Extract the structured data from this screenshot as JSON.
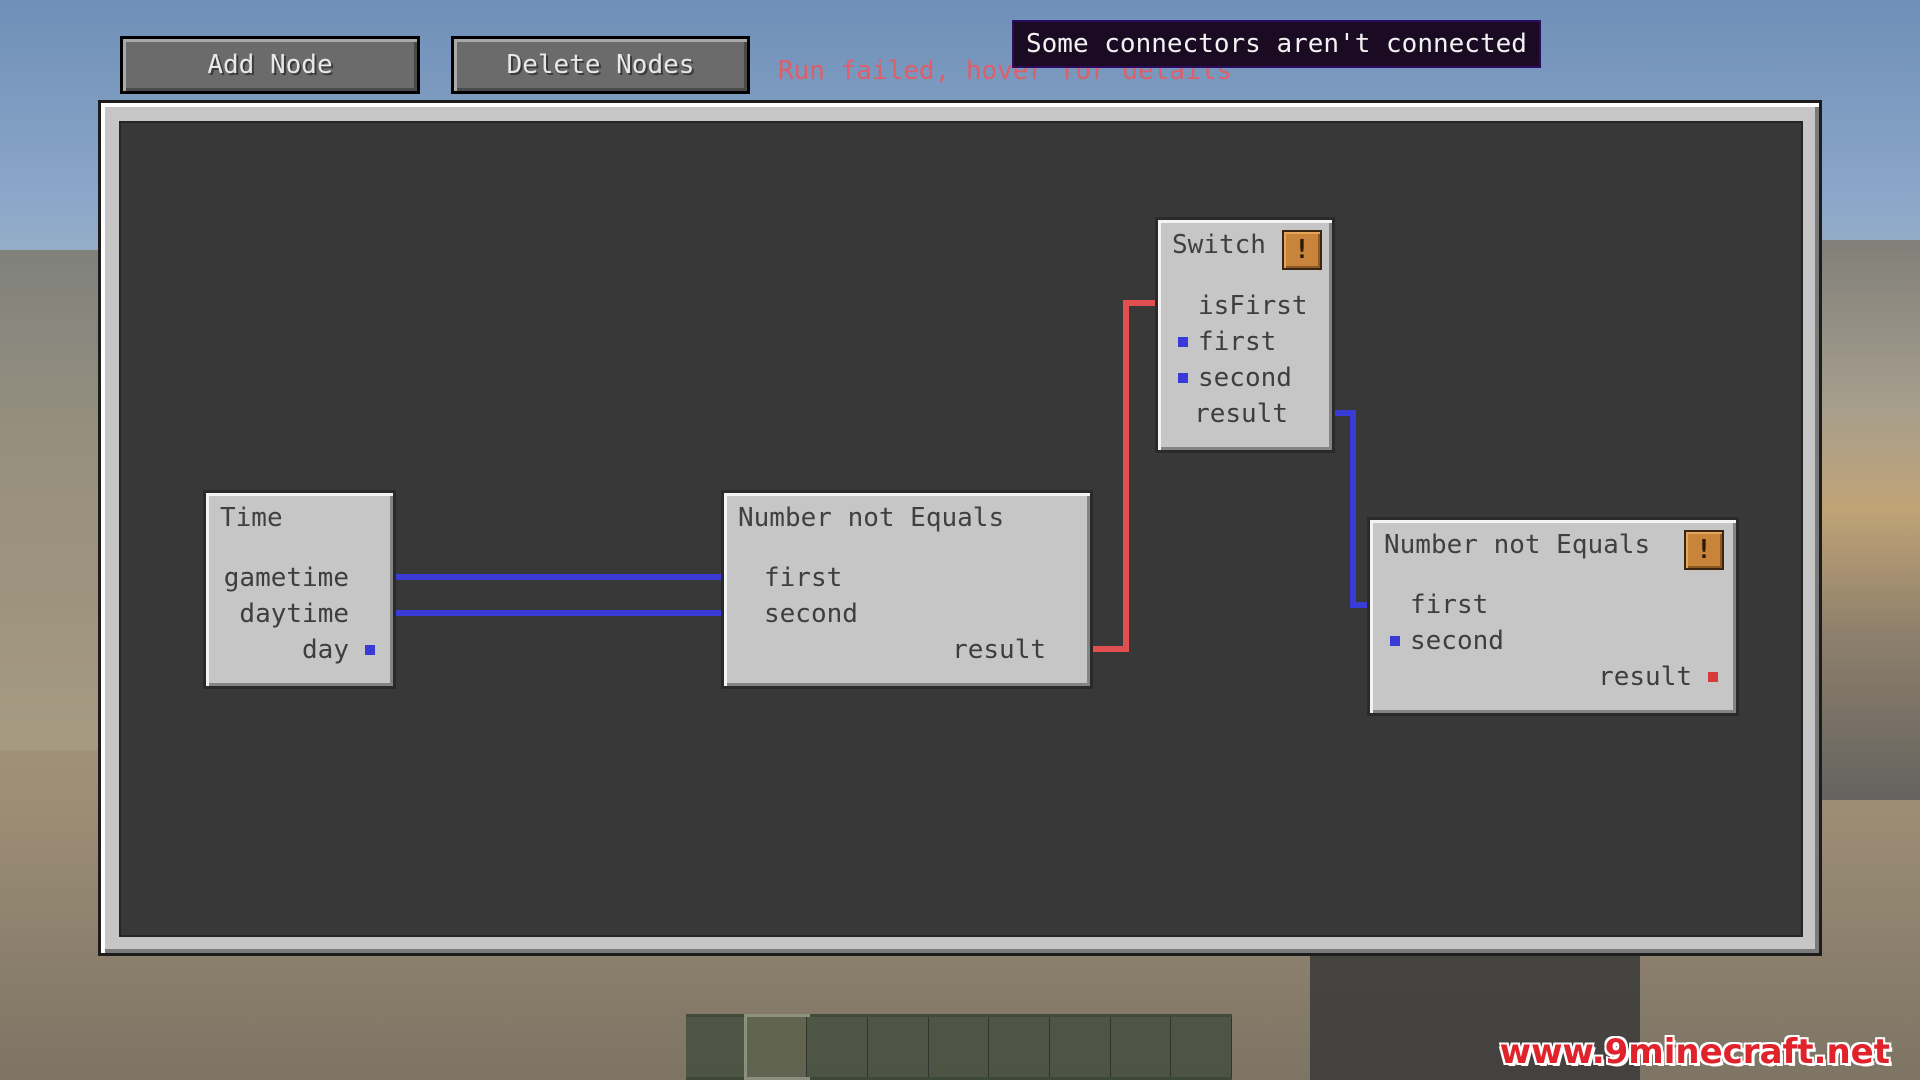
{
  "toolbar": {
    "add_node_label": "Add Node",
    "delete_nodes_label": "Delete Nodes",
    "status": "Run failed, hover for details"
  },
  "tooltip": {
    "text": "Some connectors aren't connected"
  },
  "nodes": {
    "time": {
      "title": "Time",
      "outputs": [
        "gametime",
        "daytime",
        "day"
      ]
    },
    "neq1": {
      "title": "Number not Equals",
      "inputs": [
        "first",
        "second"
      ],
      "outputs": [
        "result"
      ]
    },
    "switch": {
      "title": "Switch",
      "warning": "!",
      "inputs": [
        "isFirst",
        "first",
        "second"
      ],
      "outputs": [
        "result"
      ]
    },
    "neq2": {
      "title": "Number not Equals",
      "warning": "!",
      "inputs": [
        "first",
        "second"
      ],
      "outputs": [
        "result"
      ]
    }
  },
  "colors": {
    "number_wire": "#3a3ad8",
    "boolean_wire": "#e05050",
    "error_text": "#ff4d4d",
    "tooltip_bg": "#1a0b22",
    "watermark": "#e0222b"
  },
  "watermark": "www.9minecraft.net"
}
